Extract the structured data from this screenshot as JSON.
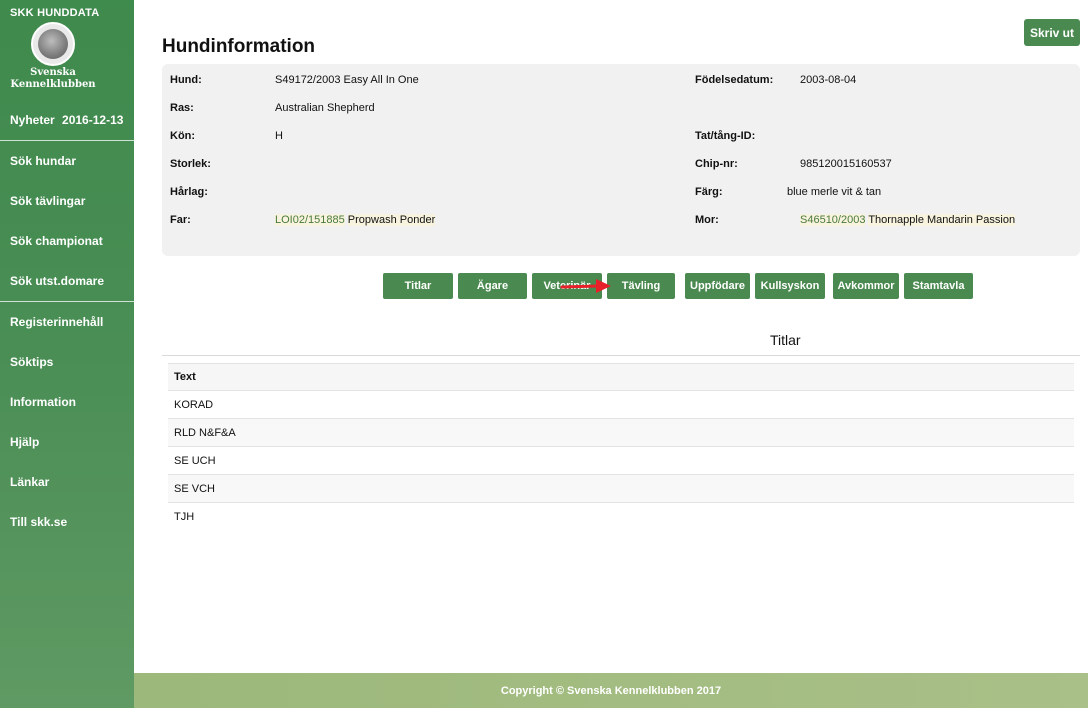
{
  "sidebar": {
    "logo_title": "SKK HUNDDATA",
    "logo_line1": "Svenska",
    "logo_line2": "Kennelklubben",
    "news_label": "Nyheter",
    "news_date": "2016-12-13",
    "nav_group1": [
      "Sök hundar",
      "Sök tävlingar",
      "Sök championat",
      "Sök utst.domare"
    ],
    "nav_group2": [
      "Registerinnehåll",
      "Söktips",
      "Information",
      "Hjälp",
      "Länkar",
      "Till skk.se"
    ]
  },
  "header": {
    "print_label": "Skriv ut",
    "title": "Hundinformation"
  },
  "info": {
    "hund_label": "Hund:",
    "hund_value": "S49172/2003 Easy All In One",
    "ras_label": "Ras:",
    "ras_value": "Australian Shepherd",
    "kon_label": "Kön:",
    "kon_value": "H",
    "storlek_label": "Storlek:",
    "storlek_value": "",
    "harlag_label": "Hårlag:",
    "harlag_value": "",
    "far_label": "Far:",
    "far_code": "LOI02/151885",
    "far_name": "Propwash Ponder",
    "fodelse_label": "Födelsedatum:",
    "fodelse_value": "2003-08-04",
    "tat_label": "Tat/tång-ID:",
    "tat_value": "",
    "chip_label": "Chip-nr:",
    "chip_value": "985120015160537",
    "farg_label": "Färg:",
    "farg_value": "blue merle vit & tan",
    "mor_label": "Mor:",
    "mor_code": "S46510/2003",
    "mor_name": "Thornapple Mandarin Passion"
  },
  "tabs": [
    "Titlar",
    "Ägare",
    "Veterinär",
    "Tävling",
    "Uppfödare",
    "Kullsyskon",
    "Avkommor",
    "Stamtavla"
  ],
  "section": {
    "title": "Titlar",
    "column_header": "Text",
    "rows": [
      "KORAD",
      "RLD N&F&A",
      "SE UCH",
      "SE VCH",
      "TJH"
    ]
  },
  "footer": {
    "copyright": "Copyright © Svenska Kennelklubben 2017"
  },
  "colors": {
    "sidebar_green": "#4a8e55",
    "button_green": "#4a8a50",
    "footer_green": "#a9c088",
    "arrow_red": "#e8202a"
  }
}
